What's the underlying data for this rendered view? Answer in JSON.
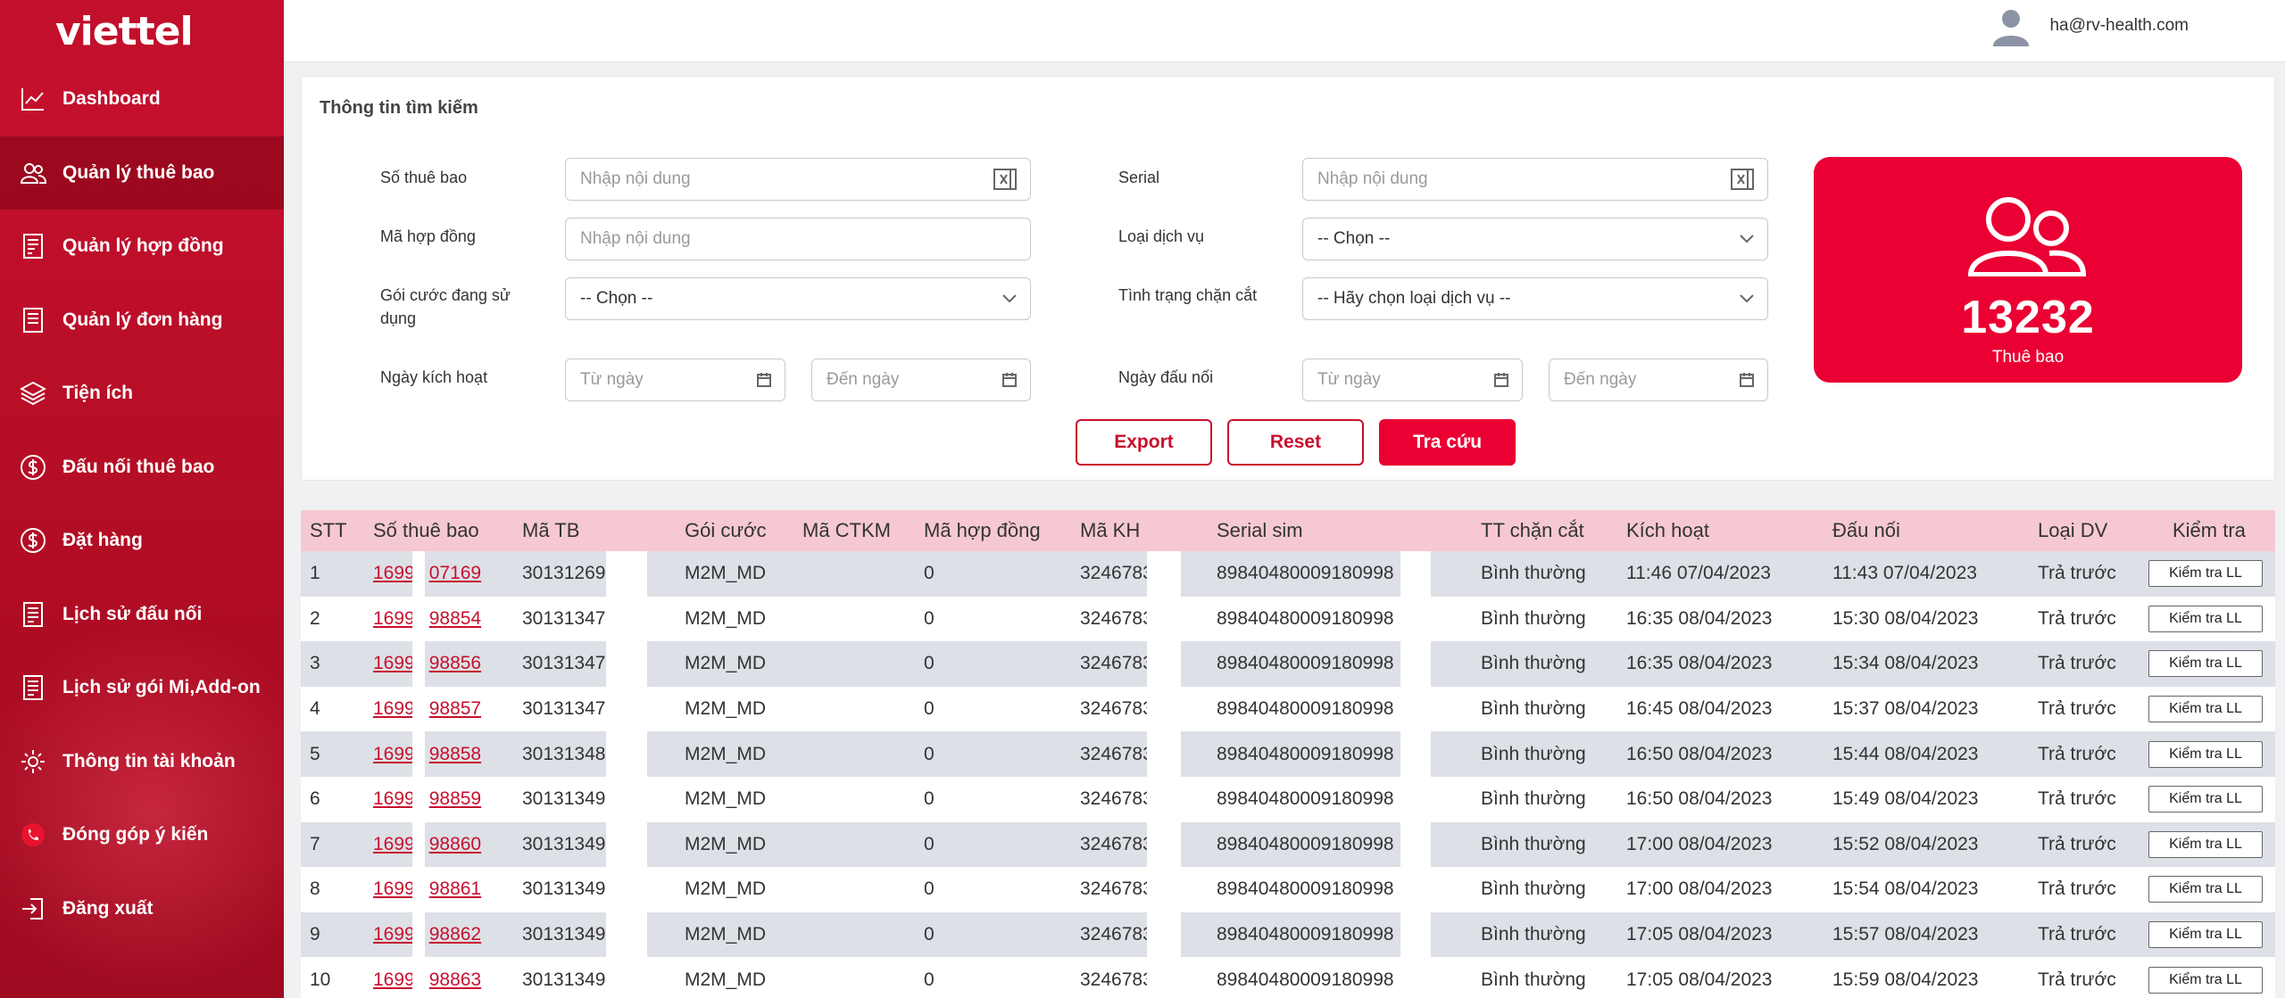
{
  "app": {
    "logo": "viettel",
    "user_email": "ha@rv-health.com"
  },
  "sidebar": {
    "items": [
      {
        "label": "Dashboard",
        "icon": "chart-line-icon",
        "active": false
      },
      {
        "label": "Quản lý thuê bao",
        "icon": "users-icon",
        "active": true
      },
      {
        "label": "Quản lý hợp đồng",
        "icon": "contract-icon",
        "active": false
      },
      {
        "label": "Quản lý đơn hàng",
        "icon": "order-icon",
        "active": false
      },
      {
        "label": "Tiện ích",
        "icon": "layers-icon",
        "active": false
      },
      {
        "label": "Đấu nối thuê bao",
        "icon": "dollar-icon",
        "active": false
      },
      {
        "label": "Đặt hàng",
        "icon": "dollar-icon",
        "active": false
      },
      {
        "label": "Lịch sử đấu nối",
        "icon": "history-icon",
        "active": false
      },
      {
        "label": "Lịch sử gói Mi,Add-on",
        "icon": "history-icon",
        "active": false
      },
      {
        "label": "Thông tin tài khoản",
        "icon": "gear-icon",
        "active": false
      },
      {
        "label": "Đóng góp ý kiến",
        "icon": "phone-icon",
        "active": false
      },
      {
        "label": "Đăng xuất",
        "icon": "logout-icon",
        "active": false
      }
    ]
  },
  "search": {
    "title": "Thông tin tìm kiếm",
    "so_thue_bao": {
      "label": "Số thuê bao",
      "placeholder": "Nhập nội dung"
    },
    "ma_hop_dong": {
      "label": "Mã hợp đồng",
      "placeholder": "Nhập nội dung"
    },
    "goi_cuoc": {
      "label": "Gói cước đang sử dụng",
      "value": "-- Chọn --"
    },
    "ngay_kich_hoat": {
      "label": "Ngày kích hoạt",
      "from": "Từ ngày",
      "to": "Đến ngày"
    },
    "serial": {
      "label": "Serial",
      "placeholder": "Nhập nội dung"
    },
    "loai_dich_vu": {
      "label": "Loại dịch vụ",
      "value": "-- Chọn --"
    },
    "tinh_trang": {
      "label": "Tình trạng chặn cắt",
      "value": "-- Hãy chọn loại dịch vụ --"
    },
    "ngay_dau_noi": {
      "label": "Ngày đấu nối",
      "from": "Từ ngày",
      "to": "Đến ngày"
    },
    "buttons": {
      "export": "Export",
      "reset": "Reset",
      "search": "Tra cứu"
    }
  },
  "stat": {
    "count": "13232",
    "caption": "Thuê bao"
  },
  "table": {
    "columns": [
      "STT",
      "Số thuê bao",
      "Mã TB",
      "Gói cước",
      "Mã CTKM",
      "Mã hợp đồng",
      "Mã KH",
      "Serial sim",
      "TT chặn cắt",
      "Kích hoạt",
      "Đấu nối",
      "Loại DV",
      "Kiểm tra"
    ],
    "rows": [
      {
        "stt": "1",
        "tb_a": "1699",
        "tb_b": "07169",
        "ma_tb": "30131269",
        "goi": "M2M_MD",
        "ctkm": "",
        "hd": "0",
        "kh": "3246783",
        "serial": "89840480009180998",
        "tt": "Bình thường",
        "kich_hoat": "11:46 07/04/2023",
        "dau_noi": "11:43 07/04/2023",
        "loai": "Trả trước",
        "btn": "Kiểm tra LL"
      },
      {
        "stt": "2",
        "tb_a": "1699",
        "tb_b": "98854",
        "ma_tb": "30131347",
        "goi": "M2M_MD",
        "ctkm": "",
        "hd": "0",
        "kh": "3246783",
        "serial": "89840480009180998",
        "tt": "Bình thường",
        "kich_hoat": "16:35 08/04/2023",
        "dau_noi": "15:30 08/04/2023",
        "loai": "Trả trước",
        "btn": "Kiểm tra LL"
      },
      {
        "stt": "3",
        "tb_a": "1699",
        "tb_b": "98856",
        "ma_tb": "30131347",
        "goi": "M2M_MD",
        "ctkm": "",
        "hd": "0",
        "kh": "3246783",
        "serial": "89840480009180998",
        "tt": "Bình thường",
        "kich_hoat": "16:35 08/04/2023",
        "dau_noi": "15:34 08/04/2023",
        "loai": "Trả trước",
        "btn": "Kiểm tra LL"
      },
      {
        "stt": "4",
        "tb_a": "1699",
        "tb_b": "98857",
        "ma_tb": "30131347",
        "goi": "M2M_MD",
        "ctkm": "",
        "hd": "0",
        "kh": "3246783",
        "serial": "89840480009180998",
        "tt": "Bình thường",
        "kich_hoat": "16:45 08/04/2023",
        "dau_noi": "15:37 08/04/2023",
        "loai": "Trả trước",
        "btn": "Kiểm tra LL"
      },
      {
        "stt": "5",
        "tb_a": "1699",
        "tb_b": "98858",
        "ma_tb": "30131348",
        "goi": "M2M_MD",
        "ctkm": "",
        "hd": "0",
        "kh": "3246783",
        "serial": "89840480009180998",
        "tt": "Bình thường",
        "kich_hoat": "16:50 08/04/2023",
        "dau_noi": "15:44 08/04/2023",
        "loai": "Trả trước",
        "btn": "Kiểm tra LL"
      },
      {
        "stt": "6",
        "tb_a": "1699",
        "tb_b": "98859",
        "ma_tb": "30131349",
        "goi": "M2M_MD",
        "ctkm": "",
        "hd": "0",
        "kh": "3246783",
        "serial": "89840480009180998",
        "tt": "Bình thường",
        "kich_hoat": "16:50 08/04/2023",
        "dau_noi": "15:49 08/04/2023",
        "loai": "Trả trước",
        "btn": "Kiểm tra LL"
      },
      {
        "stt": "7",
        "tb_a": "1699",
        "tb_b": "98860",
        "ma_tb": "30131349",
        "goi": "M2M_MD",
        "ctkm": "",
        "hd": "0",
        "kh": "3246783",
        "serial": "89840480009180998",
        "tt": "Bình thường",
        "kich_hoat": "17:00 08/04/2023",
        "dau_noi": "15:52 08/04/2023",
        "loai": "Trả trước",
        "btn": "Kiểm tra LL"
      },
      {
        "stt": "8",
        "tb_a": "1699",
        "tb_b": "98861",
        "ma_tb": "30131349",
        "goi": "M2M_MD",
        "ctkm": "",
        "hd": "0",
        "kh": "3246783",
        "serial": "89840480009180998",
        "tt": "Bình thường",
        "kich_hoat": "17:00 08/04/2023",
        "dau_noi": "15:54 08/04/2023",
        "loai": "Trả trước",
        "btn": "Kiểm tra LL"
      },
      {
        "stt": "9",
        "tb_a": "1699",
        "tb_b": "98862",
        "ma_tb": "30131349",
        "goi": "M2M_MD",
        "ctkm": "",
        "hd": "0",
        "kh": "3246783",
        "serial": "89840480009180998",
        "tt": "Bình thường",
        "kich_hoat": "17:05 08/04/2023",
        "dau_noi": "15:57 08/04/2023",
        "loai": "Trả trước",
        "btn": "Kiểm tra LL"
      },
      {
        "stt": "10",
        "tb_a": "1699",
        "tb_b": "98863",
        "ma_tb": "30131349",
        "goi": "M2M_MD",
        "ctkm": "",
        "hd": "0",
        "kh": "3246783",
        "serial": "89840480009180998",
        "tt": "Bình thường",
        "kich_hoat": "17:05 08/04/2023",
        "dau_noi": "15:59 08/04/2023",
        "loai": "Trả trước",
        "btn": "Kiểm tra LL"
      }
    ]
  },
  "colors": {
    "brand": "#c8102e",
    "accent": "#ea0033",
    "header_row": "#f6c9d2",
    "odd_row": "#dde0e6"
  }
}
